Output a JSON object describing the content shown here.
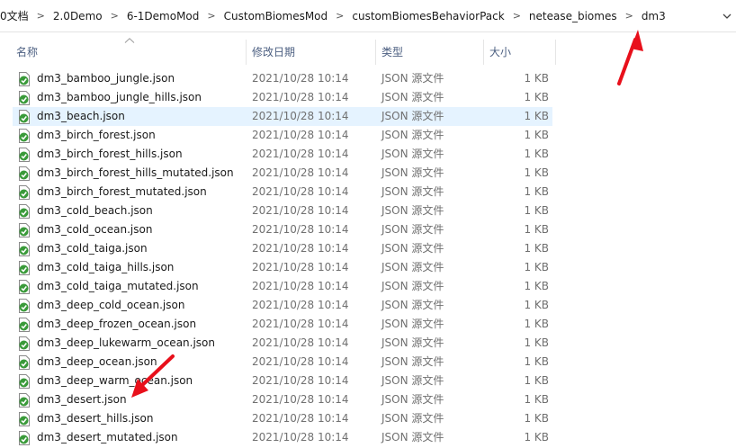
{
  "breadcrumb": [
    "0文档",
    "2.0Demo",
    "6-1DemoMod",
    "CustomBiomesMod",
    "customBiomesBehaviorPack",
    "netease_biomes",
    "dm3"
  ],
  "breadcrumb_separator": ">",
  "columns": {
    "name": "名称",
    "date": "修改日期",
    "type": "类型",
    "size": "大小"
  },
  "files": [
    {
      "name": "dm3_bamboo_jungle.json",
      "date": "2021/10/28 10:14",
      "type": "JSON 源文件",
      "size": "1 KB"
    },
    {
      "name": "dm3_bamboo_jungle_hills.json",
      "date": "2021/10/28 10:14",
      "type": "JSON 源文件",
      "size": "1 KB"
    },
    {
      "name": "dm3_beach.json",
      "date": "2021/10/28 10:14",
      "type": "JSON 源文件",
      "size": "1 KB",
      "selected": true
    },
    {
      "name": "dm3_birch_forest.json",
      "date": "2021/10/28 10:14",
      "type": "JSON 源文件",
      "size": "1 KB"
    },
    {
      "name": "dm3_birch_forest_hills.json",
      "date": "2021/10/28 10:14",
      "type": "JSON 源文件",
      "size": "1 KB"
    },
    {
      "name": "dm3_birch_forest_hills_mutated.json",
      "date": "2021/10/28 10:14",
      "type": "JSON 源文件",
      "size": "1 KB"
    },
    {
      "name": "dm3_birch_forest_mutated.json",
      "date": "2021/10/28 10:14",
      "type": "JSON 源文件",
      "size": "1 KB"
    },
    {
      "name": "dm3_cold_beach.json",
      "date": "2021/10/28 10:14",
      "type": "JSON 源文件",
      "size": "1 KB"
    },
    {
      "name": "dm3_cold_ocean.json",
      "date": "2021/10/28 10:14",
      "type": "JSON 源文件",
      "size": "1 KB"
    },
    {
      "name": "dm3_cold_taiga.json",
      "date": "2021/10/28 10:14",
      "type": "JSON 源文件",
      "size": "1 KB"
    },
    {
      "name": "dm3_cold_taiga_hills.json",
      "date": "2021/10/28 10:14",
      "type": "JSON 源文件",
      "size": "1 KB"
    },
    {
      "name": "dm3_cold_taiga_mutated.json",
      "date": "2021/10/28 10:14",
      "type": "JSON 源文件",
      "size": "1 KB"
    },
    {
      "name": "dm3_deep_cold_ocean.json",
      "date": "2021/10/28 10:14",
      "type": "JSON 源文件",
      "size": "1 KB"
    },
    {
      "name": "dm3_deep_frozen_ocean.json",
      "date": "2021/10/28 10:14",
      "type": "JSON 源文件",
      "size": "1 KB"
    },
    {
      "name": "dm3_deep_lukewarm_ocean.json",
      "date": "2021/10/28 10:14",
      "type": "JSON 源文件",
      "size": "1 KB"
    },
    {
      "name": "dm3_deep_ocean.json",
      "date": "2021/10/28 10:14",
      "type": "JSON 源文件",
      "size": "1 KB"
    },
    {
      "name": "dm3_deep_warm_ocean.json",
      "date": "2021/10/28 10:14",
      "type": "JSON 源文件",
      "size": "1 KB"
    },
    {
      "name": "dm3_desert.json",
      "date": "2021/10/28 10:14",
      "type": "JSON 源文件",
      "size": "1 KB"
    },
    {
      "name": "dm3_desert_hills.json",
      "date": "2021/10/28 10:14",
      "type": "JSON 源文件",
      "size": "1 KB"
    },
    {
      "name": "dm3_desert_mutated.json",
      "date": "2021/10/28 10:14",
      "type": "JSON 源文件",
      "size": "1 KB"
    }
  ],
  "colors": {
    "selection": "#e5f3ff",
    "header_text": "#4d6082",
    "arrow": "#e8101b",
    "file_icon": "#3a9a3a"
  },
  "icons": {
    "file": "json-file-icon",
    "dropdown": "chevron-down-icon",
    "sort": "sort-up-icon",
    "annotation": "red-arrow-annotation"
  }
}
